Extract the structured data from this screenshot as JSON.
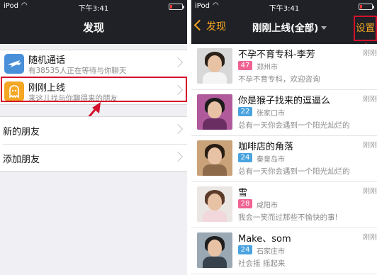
{
  "left": {
    "status": {
      "carrier": "iPod",
      "time": "下午3:41",
      "battery_level": 0.2
    },
    "nav_title": "发现",
    "rows": [
      {
        "title": "随机通话",
        "subtitle": "有38535人正在等待与你聊天",
        "icon": "airplane-icon",
        "color": "#4a90d9"
      },
      {
        "title": "刚刚上线",
        "subtitle": "来这儿找与你聊得来的朋友",
        "icon": "ghost-icon",
        "color": "#f5a623"
      }
    ],
    "new_friends": "新的朋友",
    "add_friend": "添加朋友"
  },
  "right": {
    "status": {
      "carrier": "iPod",
      "time": "下午3:41",
      "battery_level": 0.2
    },
    "back_label": "发现",
    "title": "刚刚上线(全部)",
    "settings_label": "设置",
    "users": [
      {
        "name": "不孕不育专科-李芳",
        "age": "47",
        "gender": "female",
        "city": "郑州市",
        "signature": "不孕不育专科，欢迎咨询",
        "ago": "刚刚"
      },
      {
        "name": "你是猴子找来的逗逼么",
        "age": "22",
        "gender": "male",
        "city": "张家口市",
        "signature": "总有一天你会遇到一个阳光灿烂的",
        "ago": "刚刚"
      },
      {
        "name": "咖啡店的角落",
        "age": "24",
        "gender": "male",
        "city": "秦皇岛市",
        "signature": "总有一天你会遇到一个阳光灿烂的",
        "ago": "刚刚"
      },
      {
        "name": "雪",
        "age": "28",
        "gender": "female",
        "city": "咸阳市",
        "signature": "我会一笑而过那些不愉快的事!",
        "ago": "刚刚"
      },
      {
        "name": "Make、som",
        "age": "24",
        "gender": "male",
        "city": "石家庄市",
        "signature": "社会摇 摇起来",
        "ago": "刚刚"
      }
    ]
  },
  "colors": {
    "header": "#1f2126",
    "accent": "#f5a623",
    "highlight": "#d3112a",
    "female_badge": "#f06292",
    "male_badge": "#4aa3df"
  }
}
